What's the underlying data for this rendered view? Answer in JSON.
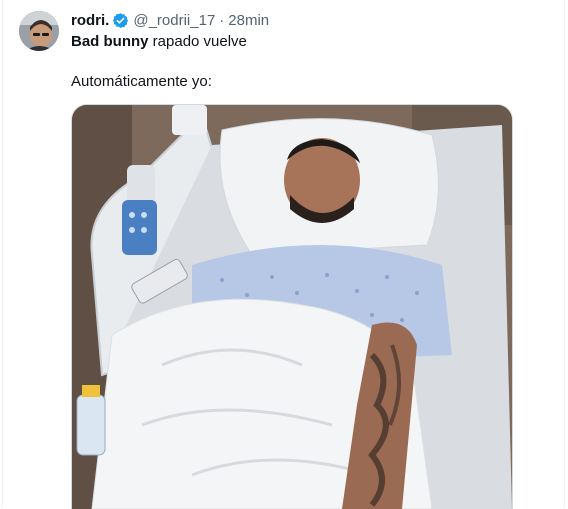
{
  "author": {
    "display_name": "rodri.",
    "handle": "@_rodrii_17",
    "separator": "·",
    "timestamp": "28min",
    "verified": true,
    "verified_color": "#1d9bf0"
  },
  "tweet": {
    "line1_bold": "Bad bunny",
    "line1_rest": " rapado vuelve",
    "line2": "Automáticamente yo:"
  },
  "media": {
    "type": "photo",
    "subject": "man sleeping in hospital bed"
  },
  "icons": {
    "verified": "verified-badge-icon"
  }
}
